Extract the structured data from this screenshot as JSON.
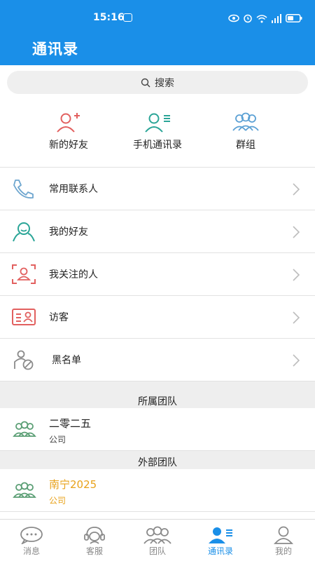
{
  "status": {
    "time": "15:16"
  },
  "header": {
    "title": "通讯录"
  },
  "search": {
    "label": "搜索"
  },
  "quick_actions": [
    {
      "label": "新的好友",
      "icon": "add-friend-icon",
      "color": "#e2605f"
    },
    {
      "label": "手机通讯录",
      "icon": "phone-contacts-icon",
      "color": "#2aa597"
    },
    {
      "label": "群组",
      "icon": "group-icon",
      "color": "#5aa0d4"
    }
  ],
  "menu": [
    {
      "label": "常用联系人",
      "icon": "phone-icon"
    },
    {
      "label": "我的好友",
      "icon": "friends-icon"
    },
    {
      "label": "我关注的人",
      "icon": "follow-icon"
    },
    {
      "label": "访客",
      "icon": "visitor-icon"
    },
    {
      "label": "黑名单",
      "icon": "blacklist-icon"
    }
  ],
  "sections": {
    "own_team": {
      "title": "所属团队",
      "teams": [
        {
          "name": "二零二五",
          "type": "公司",
          "color": "#222222"
        }
      ]
    },
    "external_team": {
      "title": "外部团队",
      "teams": [
        {
          "name": "南宁2025",
          "type": "公司",
          "color": "#e8a21a"
        }
      ]
    }
  },
  "tabs": [
    {
      "label": "消息",
      "icon": "message-icon",
      "active": false
    },
    {
      "label": "客服",
      "icon": "support-icon",
      "active": false
    },
    {
      "label": "团队",
      "icon": "team-icon",
      "active": false
    },
    {
      "label": "通讯录",
      "icon": "contacts-icon",
      "active": true
    },
    {
      "label": "我的",
      "icon": "profile-icon",
      "active": false
    }
  ],
  "colors": {
    "accent": "#1a8fe8",
    "team_icon": "#5a9e74",
    "inactive": "#888888"
  }
}
